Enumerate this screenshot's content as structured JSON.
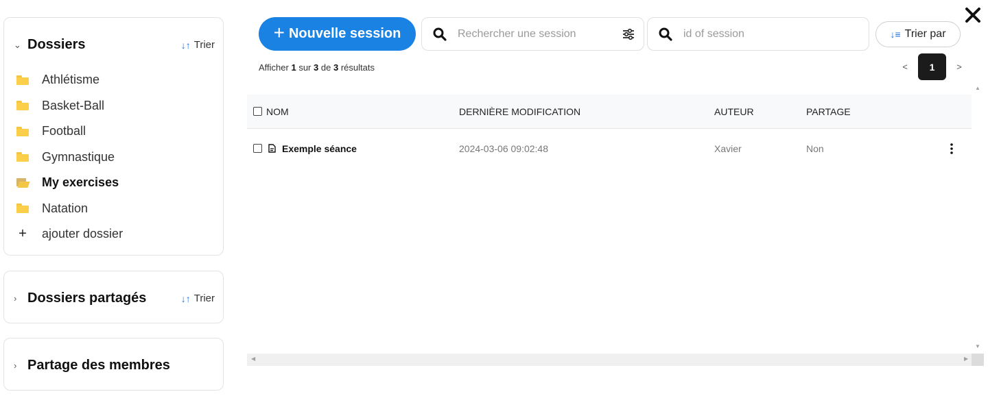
{
  "sidebar": {
    "folders": {
      "title": "Dossiers",
      "sort_label": "Trier",
      "items": [
        {
          "label": "Athlétisme",
          "icon": "folder-icon"
        },
        {
          "label": "Basket-Ball",
          "icon": "folder-icon"
        },
        {
          "label": "Football",
          "icon": "folder-icon"
        },
        {
          "label": "Gymnastique",
          "icon": "folder-icon"
        },
        {
          "label": "My exercises",
          "icon": "folder-open-icon",
          "selected": true
        },
        {
          "label": "Natation",
          "icon": "folder-icon"
        }
      ],
      "add_label": "ajouter dossier"
    },
    "shared": {
      "title": "Dossiers partagés",
      "sort_label": "Trier"
    },
    "members": {
      "title": "Partage des membres"
    }
  },
  "toolbar": {
    "new_session_label": "Nouvelle session",
    "search_placeholder": "Rechercher une session",
    "id_search_placeholder": "id of session",
    "sort_by_label": "Trier par"
  },
  "results": {
    "prefix": "Afficher",
    "shown": "1",
    "mid1": "sur",
    "total_shown": "3",
    "mid2": "de",
    "total": "3",
    "suffix": "résultats"
  },
  "pagination": {
    "prev": "<",
    "current_page": "1",
    "next": ">"
  },
  "table": {
    "headers": {
      "name": "NOM",
      "modified": "DERNIÈRE MODIFICATION",
      "author": "AUTEUR",
      "shared": "PARTAGE"
    },
    "rows": [
      {
        "name": "Exemple séance",
        "modified": "2024-03-06 09:02:48",
        "author": "Xavier",
        "shared": "Non"
      }
    ]
  },
  "colors": {
    "accent": "#1a82e2",
    "folder": "#fbcf4a",
    "page_active": "#1b1b1b"
  }
}
